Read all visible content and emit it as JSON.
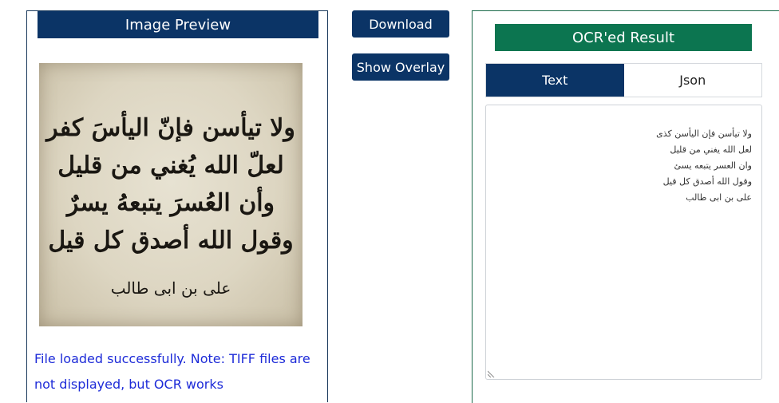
{
  "preview": {
    "header": "Image Preview",
    "image_lines": [
      "ولا تيأسن فإنّ اليأسَ كفر",
      "لعلّ الله يُغني من قليل",
      "وأن العُسرَ يتبعهُ يسرٌ",
      "وقول الله أصدق كل قيل"
    ],
    "image_signature": "على بن ابى طالب",
    "status": "File loaded successfully. Note: TIFF files are not displayed, but OCR works"
  },
  "actions": {
    "download_label": "Download",
    "overlay_label": "Show Overlay"
  },
  "result": {
    "header": "OCR'ed Result",
    "tabs": [
      {
        "label": "Text",
        "active": true
      },
      {
        "label": "Json",
        "active": false
      }
    ],
    "lines": [
      "ولا تيأسن فإن اليأسن كذى",
      "لعل الله يغني من قليل",
      "وان العسر يتبعه يسئ",
      "وقول الله أصدق كل قيل",
      "على بن ابى طالب"
    ]
  },
  "colors": {
    "navy": "#0b3466",
    "green": "#0c7550",
    "status_blue": "#1d2bd8"
  },
  "icons": {
    "resize": "resize-grip-icon"
  }
}
